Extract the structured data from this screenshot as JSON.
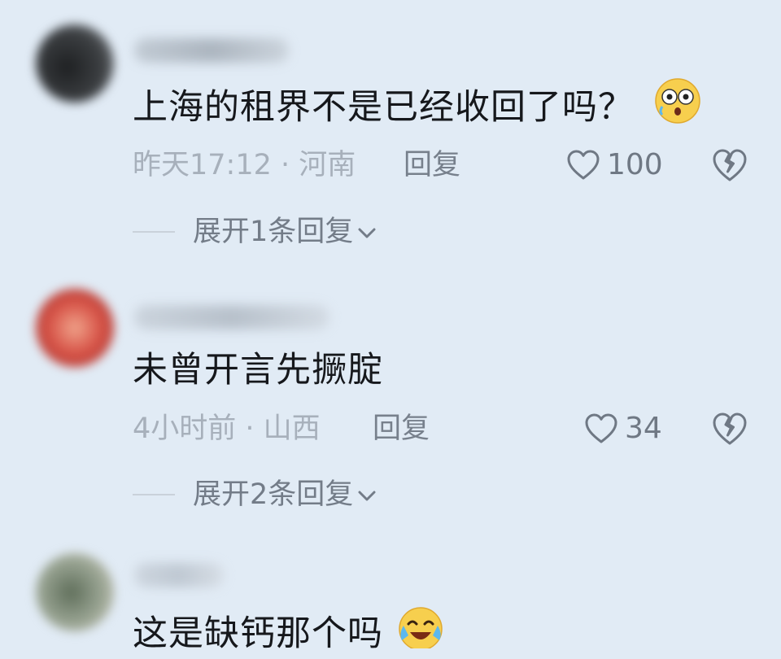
{
  "comments": [
    {
      "text": "上海的租界不是已经收回了吗？",
      "emoji": "dizzy-face-emoji",
      "time": "昨天17:12",
      "location": "河南",
      "meta": "昨天17:12 · 河南",
      "reply_label": "回复",
      "likes": "100",
      "expand_label": "展开1条回复",
      "avatar_colors": [
        "#2a2c2e",
        "#6a6e70"
      ]
    },
    {
      "text": "未曾开言先撅腚",
      "emoji": "",
      "time": "4小时前",
      "location": "山西",
      "meta": "4小时前 · 山西",
      "reply_label": "回复",
      "likes": "34",
      "expand_label": "展开2条回复",
      "avatar_colors": [
        "#b8302a",
        "#e07a5f"
      ]
    },
    {
      "text": "这是缺钙那个吗",
      "emoji": "crying-laughing-emoji",
      "avatar_colors": [
        "#7a8a76",
        "#c2b8a6"
      ]
    }
  ],
  "icons": {
    "like": "heart-icon",
    "dislike": "broken-heart-icon",
    "expand": "chevron-down-icon"
  },
  "colors": {
    "background": "#e1ebf5",
    "meta_text": "#a7b0bb",
    "action_text": "#737c88"
  }
}
